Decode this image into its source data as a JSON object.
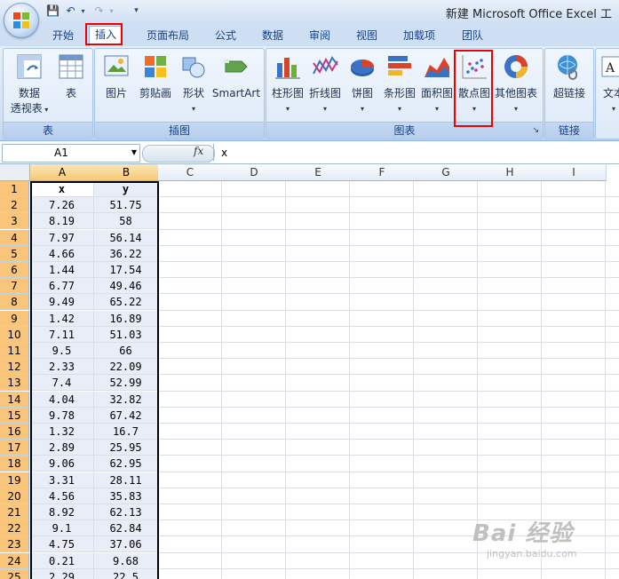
{
  "title": "新建 Microsoft Office Excel 工",
  "colors": {
    "accent": "#15428b",
    "highlight": "#e00000",
    "selection": "#f6c875"
  },
  "tabs": [
    {
      "label": "开始"
    },
    {
      "label": "插入"
    },
    {
      "label": "页面布局"
    },
    {
      "label": "公式"
    },
    {
      "label": "数据"
    },
    {
      "label": "审阅"
    },
    {
      "label": "视图"
    },
    {
      "label": "加载项"
    },
    {
      "label": "团队"
    }
  ],
  "active_tab": "插入",
  "ribbon": {
    "groups": [
      {
        "label": "表"
      },
      {
        "label": "插图"
      },
      {
        "label": "图表"
      },
      {
        "label": "链接"
      }
    ],
    "buttons": {
      "pivot": {
        "line1": "数据",
        "line2": "透视表",
        "icon": "pivot-table-icon"
      },
      "table": {
        "label": "表",
        "icon": "table-icon"
      },
      "picture": {
        "label": "图片",
        "icon": "picture-icon"
      },
      "clipart": {
        "label": "剪贴画",
        "icon": "clipart-icon"
      },
      "shapes": {
        "label": "形状",
        "icon": "shapes-icon"
      },
      "smartart": {
        "label": "SmartArt",
        "icon": "smartart-icon"
      },
      "column": {
        "label": "柱形图",
        "icon": "column-chart-icon"
      },
      "line": {
        "label": "折线图",
        "icon": "line-chart-icon"
      },
      "pie": {
        "label": "饼图",
        "icon": "pie-chart-icon"
      },
      "bar": {
        "label": "条形图",
        "icon": "bar-chart-icon"
      },
      "area": {
        "label": "面积图",
        "icon": "area-chart-icon"
      },
      "scatter": {
        "label": "散点图",
        "icon": "scatter-chart-icon"
      },
      "other": {
        "label": "其他图表",
        "icon": "doughnut-chart-icon"
      },
      "hyperlink": {
        "label": "超链接",
        "icon": "hyperlink-icon"
      },
      "text": {
        "label": "文本",
        "icon": "text-box-icon"
      }
    }
  },
  "formula_bar": {
    "name_box": "A1",
    "fx": "fx",
    "content": "x"
  },
  "columns": [
    "A",
    "B",
    "C",
    "D",
    "E",
    "F",
    "G",
    "H",
    "I"
  ],
  "rows": [
    "1",
    "2",
    "3",
    "4",
    "5",
    "6",
    "7",
    "8",
    "9",
    "10",
    "11",
    "12",
    "13",
    "14",
    "15",
    "16",
    "17",
    "18",
    "19",
    "20",
    "21",
    "22",
    "23",
    "24",
    "25"
  ],
  "table": {
    "headers": [
      "x",
      "y"
    ],
    "data": [
      [
        "7.26",
        "51.75"
      ],
      [
        "8.19",
        "58"
      ],
      [
        "7.97",
        "56.14"
      ],
      [
        "4.66",
        "36.22"
      ],
      [
        "1.44",
        "17.54"
      ],
      [
        "6.77",
        "49.46"
      ],
      [
        "9.49",
        "65.22"
      ],
      [
        "1.42",
        "16.89"
      ],
      [
        "7.11",
        "51.03"
      ],
      [
        "9.5",
        "66"
      ],
      [
        "2.33",
        "22.09"
      ],
      [
        "7.4",
        "52.99"
      ],
      [
        "4.04",
        "32.82"
      ],
      [
        "9.78",
        "67.42"
      ],
      [
        "1.32",
        "16.7"
      ],
      [
        "2.89",
        "25.95"
      ],
      [
        "9.06",
        "62.95"
      ],
      [
        "3.31",
        "28.11"
      ],
      [
        "4.56",
        "35.83"
      ],
      [
        "8.92",
        "62.13"
      ],
      [
        "9.1",
        "62.84"
      ],
      [
        "4.75",
        "37.06"
      ],
      [
        "0.21",
        "9.68"
      ],
      [
        "2.29",
        "22.5"
      ]
    ]
  },
  "watermark": {
    "brand": "Bai 经验",
    "url": "jingyan.baidu.com"
  }
}
